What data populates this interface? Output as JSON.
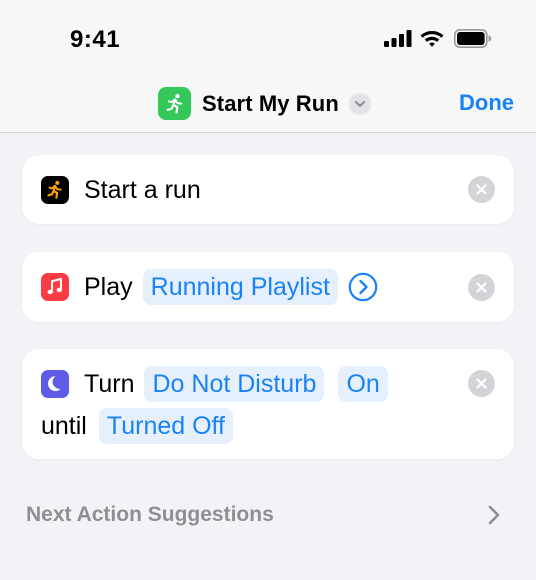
{
  "status_bar": {
    "time": "9:41"
  },
  "header": {
    "title": "Start My Run",
    "done_label": "Done"
  },
  "actions": [
    {
      "icon": "running-figure-icon",
      "icon_bg": "#000000",
      "text": "Start a run"
    },
    {
      "icon": "music-note-icon",
      "icon_bg": "#fc3c44",
      "verb": "Play",
      "token": "Running Playlist"
    },
    {
      "icon": "moon-icon",
      "icon_bg": "#5e5ce6",
      "verb": "Turn",
      "token": "Do Not Disturb",
      "state_token": "On",
      "until_label": "until",
      "until_token": "Turned Off"
    }
  ],
  "suggestions": {
    "label": "Next Action Suggestions"
  },
  "colors": {
    "accent": "#1a82f7",
    "app_icon": "#34c759",
    "token_bg": "#e6f0fd"
  }
}
